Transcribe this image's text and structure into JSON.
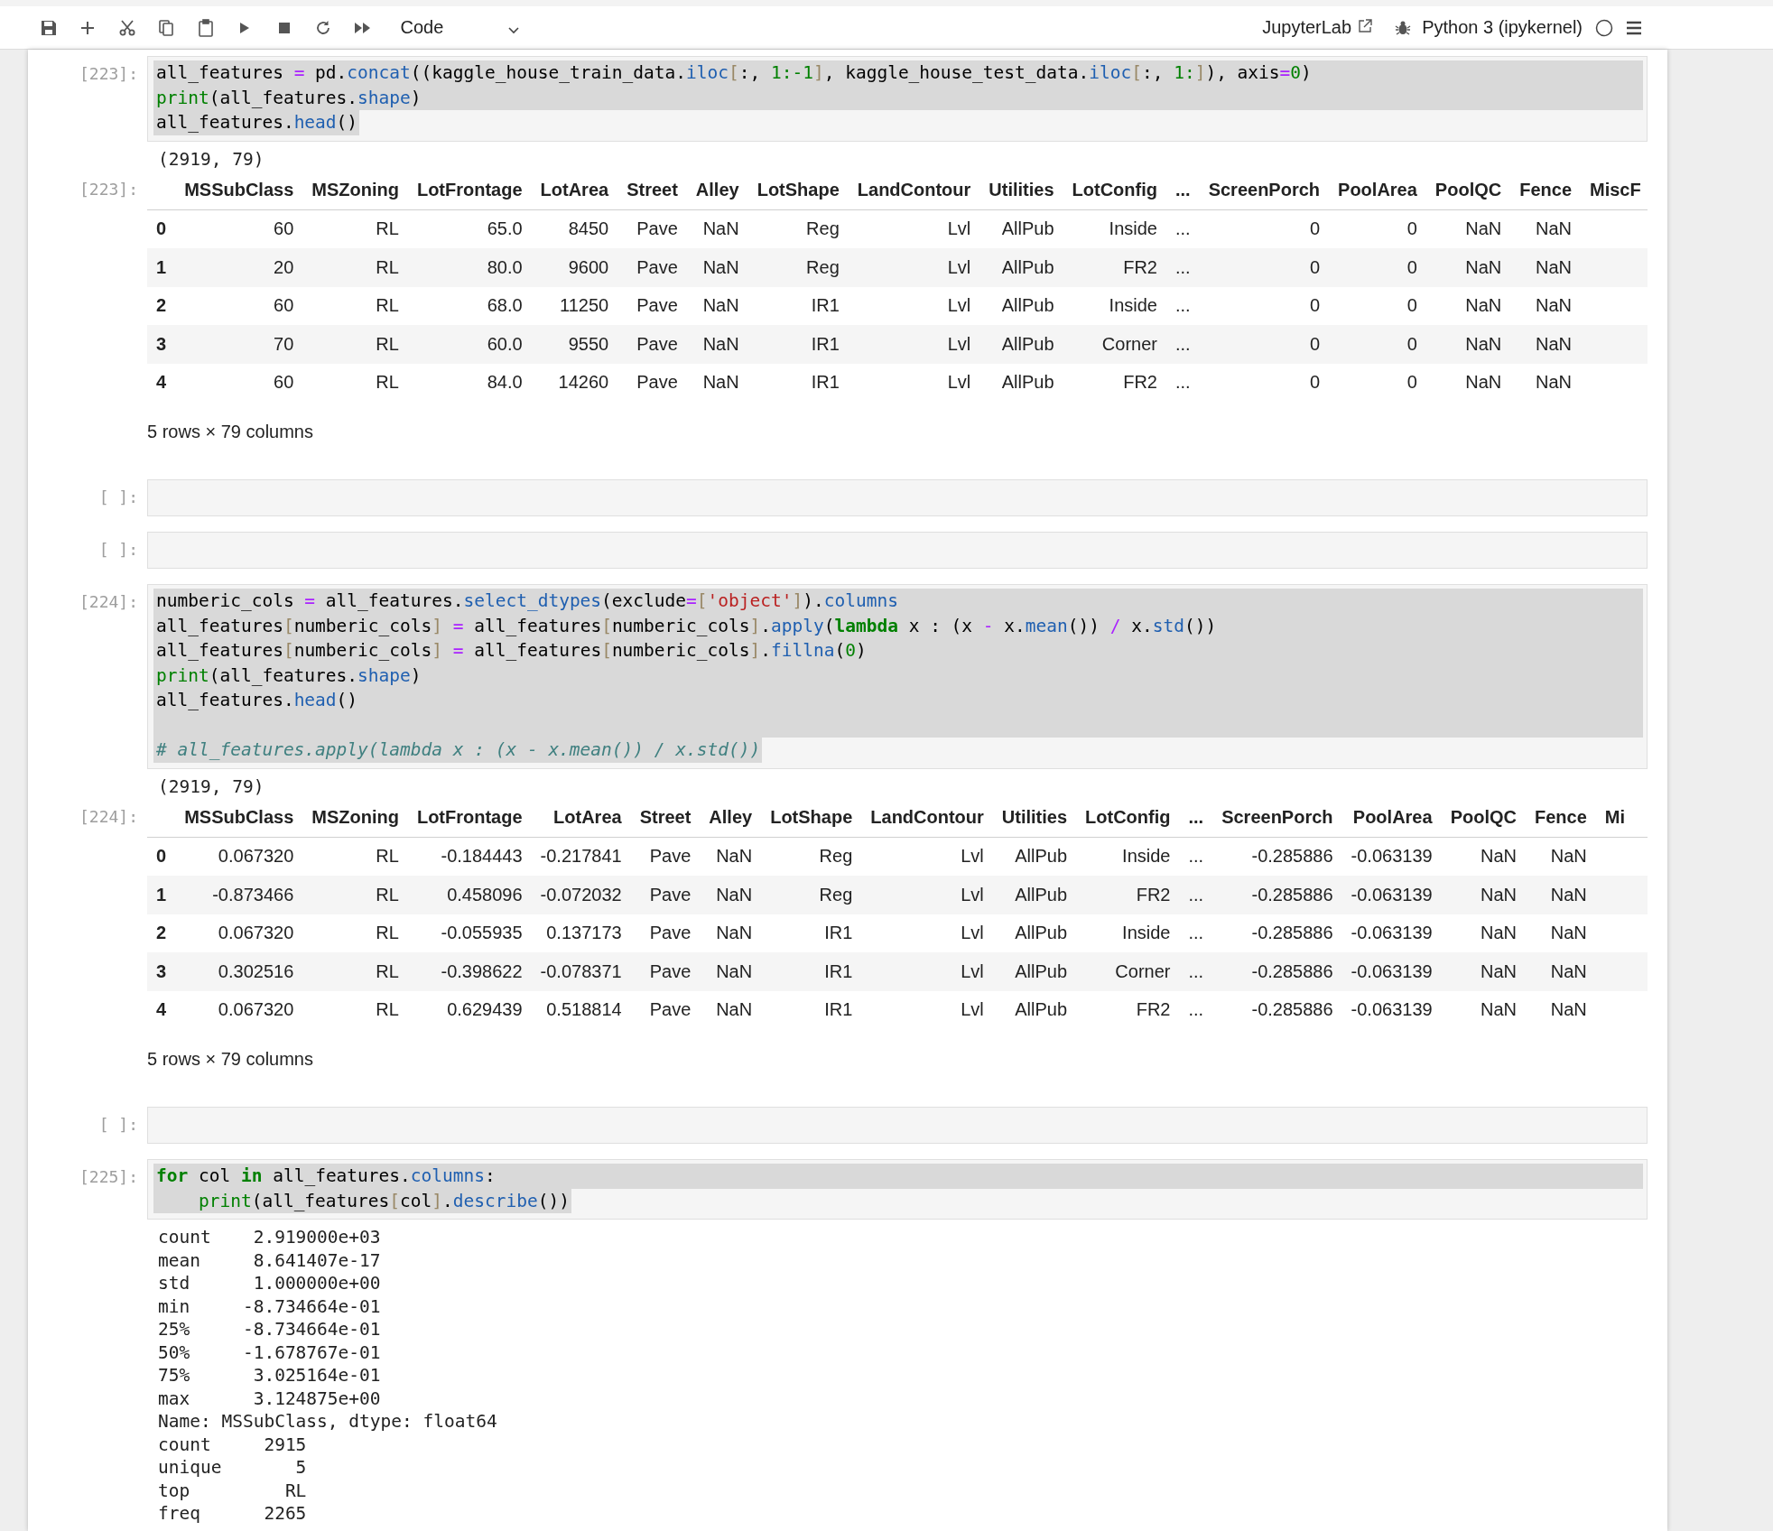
{
  "toolbar": {
    "cell_type": "Code",
    "launcher": "JupyterLab",
    "kernel": "Python 3 (ipykernel)",
    "kernel_busy": false
  },
  "cells": [
    {
      "kind": "code",
      "prompt": "[223]:",
      "text_selected": true,
      "source": [
        {
          "gap_after": false,
          "tokens": [
            {
              "text": "all_features",
              "kind": "name"
            },
            {
              "text": " =",
              "kind": "operator"
            },
            {
              "text": " pd.",
              "kind": "name"
            },
            {
              "text": "concat",
              "kind": "attribute"
            },
            {
              "text": "((kaggle_house_train_data.",
              "kind": "name"
            },
            {
              "text": "iloc",
              "kind": "attribute"
            },
            {
              "text": "[",
              "kind": "bracket"
            },
            {
              "text": ":,",
              "kind": "name"
            },
            {
              "text": " 1:-1",
              "kind": "number"
            },
            {
              "text": "]",
              "kind": "bracket"
            },
            {
              "text": ", kaggle_house_test_data.",
              "kind": "name"
            },
            {
              "text": "iloc",
              "kind": "attribute"
            },
            {
              "text": "[",
              "kind": "bracket"
            },
            {
              "text": ":,",
              "kind": "name"
            },
            {
              "text": " 1:",
              "kind": "number"
            },
            {
              "text": "]",
              "kind": "bracket"
            },
            {
              "text": "), axis",
              "kind": "name"
            },
            {
              "text": "=",
              "kind": "operator"
            },
            {
              "text": "0",
              "kind": "number"
            },
            {
              "text": ")",
              "kind": "name"
            }
          ]
        },
        {
          "gap_after": false,
          "tokens": [
            {
              "text": "print",
              "kind": "builtin"
            },
            {
              "text": "(all_features.",
              "kind": "name"
            },
            {
              "text": "shape",
              "kind": "attribute"
            },
            {
              "text": ")",
              "kind": "name"
            }
          ]
        },
        {
          "gap_after": false,
          "tokens": [
            {
              "text": "all_features.",
              "kind": "name"
            },
            {
              "text": "head",
              "kind": "attribute"
            },
            {
              "text": "()",
              "kind": "name"
            }
          ]
        }
      ],
      "outputs": [
        {
          "kind": "stream",
          "lines": [
            "(2919, 79)"
          ]
        },
        {
          "kind": "dataframe",
          "prompt": "[223]:",
          "columns": [
            "MSSubClass",
            "MSZoning",
            "LotFrontage",
            "LotArea",
            "Street",
            "Alley",
            "LotShape",
            "LandContour",
            "Utilities",
            "LotConfig",
            "...",
            "ScreenPorch",
            "PoolArea",
            "PoolQC",
            "Fence",
            "MiscF"
          ],
          "rows": [
            {
              "index": "0",
              "cells": [
                "60",
                "RL",
                "65.0",
                "8450",
                "Pave",
                "NaN",
                "Reg",
                "Lvl",
                "AllPub",
                "Inside",
                "...",
                "0",
                "0",
                "NaN",
                "NaN"
              ]
            },
            {
              "index": "1",
              "cells": [
                "20",
                "RL",
                "80.0",
                "9600",
                "Pave",
                "NaN",
                "Reg",
                "Lvl",
                "AllPub",
                "FR2",
                "...",
                "0",
                "0",
                "NaN",
                "NaN"
              ]
            },
            {
              "index": "2",
              "cells": [
                "60",
                "RL",
                "68.0",
                "11250",
                "Pave",
                "NaN",
                "IR1",
                "Lvl",
                "AllPub",
                "Inside",
                "...",
                "0",
                "0",
                "NaN",
                "NaN"
              ]
            },
            {
              "index": "3",
              "cells": [
                "70",
                "RL",
                "60.0",
                "9550",
                "Pave",
                "NaN",
                "IR1",
                "Lvl",
                "AllPub",
                "Corner",
                "...",
                "0",
                "0",
                "NaN",
                "NaN"
              ]
            },
            {
              "index": "4",
              "cells": [
                "60",
                "RL",
                "84.0",
                "14260",
                "Pave",
                "NaN",
                "IR1",
                "Lvl",
                "AllPub",
                "FR2",
                "...",
                "0",
                "0",
                "NaN",
                "NaN"
              ]
            }
          ],
          "footer": "5 rows × 79 columns"
        }
      ]
    },
    {
      "kind": "code",
      "prompt": "[ ]:",
      "text_selected": false
    },
    {
      "kind": "code",
      "prompt": "[ ]:",
      "text_selected": false
    },
    {
      "kind": "code",
      "prompt": "[224]:",
      "text_selected": true,
      "source": [
        {
          "gap_after": false,
          "tokens": [
            {
              "text": "numberic_cols",
              "kind": "name"
            },
            {
              "text": " =",
              "kind": "operator"
            },
            {
              "text": " all_features.",
              "kind": "name"
            },
            {
              "text": "select_dtypes",
              "kind": "attribute"
            },
            {
              "text": "(exclude",
              "kind": "name"
            },
            {
              "text": "=",
              "kind": "operator"
            },
            {
              "text": "[",
              "kind": "bracket"
            },
            {
              "text": "'object'",
              "kind": "string"
            },
            {
              "text": "]",
              "kind": "bracket"
            },
            {
              "text": ").",
              "kind": "name"
            },
            {
              "text": "columns",
              "kind": "attribute"
            }
          ]
        },
        {
          "gap_after": false,
          "tokens": [
            {
              "text": "all_features",
              "kind": "name"
            },
            {
              "text": "[",
              "kind": "bracket"
            },
            {
              "text": "numberic_cols",
              "kind": "name"
            },
            {
              "text": "]",
              "kind": "bracket"
            },
            {
              "text": " =",
              "kind": "operator"
            },
            {
              "text": " all_features",
              "kind": "name"
            },
            {
              "text": "[",
              "kind": "bracket"
            },
            {
              "text": "numberic_cols",
              "kind": "name"
            },
            {
              "text": "]",
              "kind": "bracket"
            },
            {
              "text": ".",
              "kind": "name"
            },
            {
              "text": "apply",
              "kind": "attribute"
            },
            {
              "text": "(",
              "kind": "name"
            },
            {
              "text": "lambda",
              "kind": "keyword"
            },
            {
              "text": " x : (x",
              "kind": "name"
            },
            {
              "text": " -",
              "kind": "operator"
            },
            {
              "text": " x.",
              "kind": "name"
            },
            {
              "text": "mean",
              "kind": "attribute"
            },
            {
              "text": "())",
              "kind": "name"
            },
            {
              "text": " /",
              "kind": "operator"
            },
            {
              "text": " x.",
              "kind": "name"
            },
            {
              "text": "std",
              "kind": "attribute"
            },
            {
              "text": "())",
              "kind": "name"
            }
          ]
        },
        {
          "gap_after": false,
          "tokens": [
            {
              "text": "all_features",
              "kind": "name"
            },
            {
              "text": "[",
              "kind": "bracket"
            },
            {
              "text": "numberic_cols",
              "kind": "name"
            },
            {
              "text": "]",
              "kind": "bracket"
            },
            {
              "text": " =",
              "kind": "operator"
            },
            {
              "text": " all_features",
              "kind": "name"
            },
            {
              "text": "[",
              "kind": "bracket"
            },
            {
              "text": "numberic_cols",
              "kind": "name"
            },
            {
              "text": "]",
              "kind": "bracket"
            },
            {
              "text": ".",
              "kind": "name"
            },
            {
              "text": "fillna",
              "kind": "attribute"
            },
            {
              "text": "(",
              "kind": "name"
            },
            {
              "text": "0",
              "kind": "number"
            },
            {
              "text": ")",
              "kind": "name"
            }
          ]
        },
        {
          "gap_after": false,
          "tokens": [
            {
              "text": "print",
              "kind": "builtin"
            },
            {
              "text": "(all_features.",
              "kind": "name"
            },
            {
              "text": "shape",
              "kind": "attribute"
            },
            {
              "text": ")",
              "kind": "name"
            }
          ]
        },
        {
          "gap_after": true,
          "tokens": [
            {
              "text": "all_features.",
              "kind": "name"
            },
            {
              "text": "head",
              "kind": "attribute"
            },
            {
              "text": "()",
              "kind": "name"
            }
          ]
        },
        {
          "gap_after": false,
          "tokens": [
            {
              "text": "# all_features.apply(lambda x : (x - x.mean()) / x.std())",
              "kind": "comment"
            }
          ]
        }
      ],
      "outputs": [
        {
          "kind": "stream",
          "lines": [
            "(2919, 79)"
          ]
        },
        {
          "kind": "dataframe",
          "prompt": "[224]:",
          "columns": [
            "MSSubClass",
            "MSZoning",
            "LotFrontage",
            "LotArea",
            "Street",
            "Alley",
            "LotShape",
            "LandContour",
            "Utilities",
            "LotConfig",
            "...",
            "ScreenPorch",
            "PoolArea",
            "PoolQC",
            "Fence",
            "Mi"
          ],
          "rows": [
            {
              "index": "0",
              "cells": [
                "0.067320",
                "RL",
                "-0.184443",
                "-0.217841",
                "Pave",
                "NaN",
                "Reg",
                "Lvl",
                "AllPub",
                "Inside",
                "...",
                "-0.285886",
                "-0.063139",
                "NaN",
                "NaN"
              ]
            },
            {
              "index": "1",
              "cells": [
                "-0.873466",
                "RL",
                "0.458096",
                "-0.072032",
                "Pave",
                "NaN",
                "Reg",
                "Lvl",
                "AllPub",
                "FR2",
                "...",
                "-0.285886",
                "-0.063139",
                "NaN",
                "NaN"
              ]
            },
            {
              "index": "2",
              "cells": [
                "0.067320",
                "RL",
                "-0.055935",
                "0.137173",
                "Pave",
                "NaN",
                "IR1",
                "Lvl",
                "AllPub",
                "Inside",
                "...",
                "-0.285886",
                "-0.063139",
                "NaN",
                "NaN"
              ]
            },
            {
              "index": "3",
              "cells": [
                "0.302516",
                "RL",
                "-0.398622",
                "-0.078371",
                "Pave",
                "NaN",
                "IR1",
                "Lvl",
                "AllPub",
                "Corner",
                "...",
                "-0.285886",
                "-0.063139",
                "NaN",
                "NaN"
              ]
            },
            {
              "index": "4",
              "cells": [
                "0.067320",
                "RL",
                "0.629439",
                "0.518814",
                "Pave",
                "NaN",
                "IR1",
                "Lvl",
                "AllPub",
                "FR2",
                "...",
                "-0.285886",
                "-0.063139",
                "NaN",
                "NaN"
              ]
            }
          ],
          "footer": "5 rows × 79 columns"
        }
      ]
    },
    {
      "kind": "code",
      "prompt": "[ ]:",
      "text_selected": false
    },
    {
      "kind": "code",
      "prompt": "[225]:",
      "text_selected": true,
      "source": [
        {
          "gap_after": false,
          "tokens": [
            {
              "text": "for",
              "kind": "keyword"
            },
            {
              "text": " col",
              "kind": "name"
            },
            {
              "text": " in",
              "kind": "keyword"
            },
            {
              "text": " all_features.",
              "kind": "name"
            },
            {
              "text": "columns",
              "kind": "attribute"
            },
            {
              "text": ":",
              "kind": "name"
            }
          ]
        },
        {
          "gap_after": false,
          "tokens": [
            {
              "text": "    print",
              "kind": "builtin"
            },
            {
              "text": "(all_features",
              "kind": "name"
            },
            {
              "text": "[",
              "kind": "bracket"
            },
            {
              "text": "col",
              "kind": "name"
            },
            {
              "text": "]",
              "kind": "bracket"
            },
            {
              "text": ".",
              "kind": "name"
            },
            {
              "text": "describe",
              "kind": "attribute"
            },
            {
              "text": "())",
              "kind": "name"
            }
          ]
        }
      ],
      "outputs": [
        {
          "kind": "stream",
          "lines": [
            "count    2.919000e+03",
            "mean     8.641407e-17",
            "std      1.000000e+00",
            "min     -8.734664e-01",
            "25%     -8.734664e-01",
            "50%     -1.678767e-01",
            "75%      3.025164e-01",
            "max      3.124875e+00",
            "Name: MSSubClass, dtype: float64",
            "count     2915",
            "unique       5",
            "top         RL",
            "freq      2265"
          ]
        }
      ]
    }
  ]
}
